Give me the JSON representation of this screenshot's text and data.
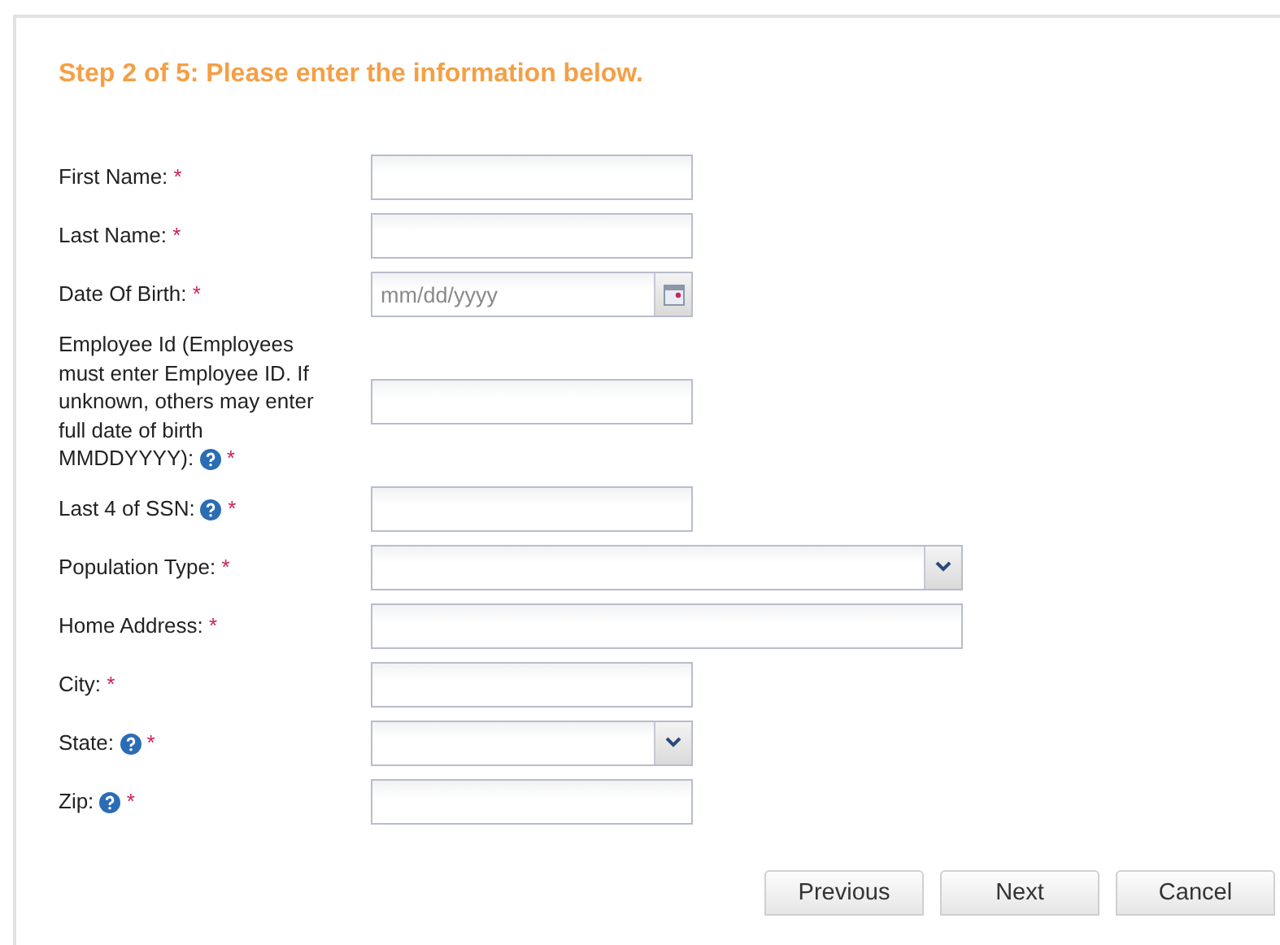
{
  "heading": "Step 2 of 5: Please enter the information below.",
  "fields": [
    {
      "label": "First Name:",
      "required_mark": "*",
      "help": false,
      "kind": "text",
      "wide": false
    },
    {
      "label": "Last Name:",
      "required_mark": "*",
      "help": false,
      "kind": "text",
      "wide": false
    },
    {
      "label": "Date Of Birth:",
      "required_mark": "*",
      "help": false,
      "kind": "date",
      "wide": false,
      "placeholder": "mm/dd/yyyy"
    },
    {
      "label": "Employee Id (Employees must enter Employee ID. If unknown, others may enter full date of birth MMDDYYYY):",
      "required_mark": "*",
      "help": true,
      "kind": "text",
      "wide": false
    },
    {
      "label": "Last 4 of SSN:",
      "required_mark": "*",
      "help": true,
      "kind": "text",
      "wide": false
    },
    {
      "label": "Population Type:",
      "required_mark": "*",
      "help": false,
      "kind": "select",
      "wide": true
    },
    {
      "label": "Home Address:",
      "required_mark": "*",
      "help": false,
      "kind": "text",
      "wide": true
    },
    {
      "label": "City:",
      "required_mark": "*",
      "help": false,
      "kind": "text",
      "wide": false
    },
    {
      "label": "State:",
      "required_mark": "*",
      "help": true,
      "kind": "select",
      "wide": false
    },
    {
      "label": "Zip:",
      "required_mark": "*",
      "help": true,
      "kind": "text",
      "wide": false
    }
  ],
  "buttons": [
    "Previous",
    "Next",
    "Cancel"
  ]
}
